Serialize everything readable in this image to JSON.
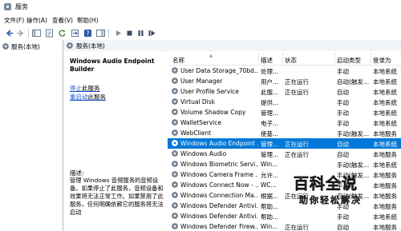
{
  "window": {
    "title": "服务"
  },
  "menu": [
    "文件(F)",
    "操作(A)",
    "查看(V)",
    "帮助(H)"
  ],
  "toolbar": {
    "icons": [
      "back-icon",
      "forward-icon",
      "console-tree-icon",
      "properties-icon",
      "refresh-icon",
      "export-icon",
      "help-icon",
      "show-hide-icon",
      "play-icon",
      "stop-icon",
      "pause-icon",
      "restart-icon"
    ]
  },
  "tree": {
    "root_label": "服务(本地)"
  },
  "panel": {
    "header": "服务(本地)"
  },
  "details": {
    "service_name": "Windows Audio Endpoint Builder",
    "stop_link": "停止",
    "stop_suffix": "此服务",
    "restart_link": "重启动",
    "restart_suffix": "此服务",
    "desc_label": "描述:",
    "desc_text": "管理 Windows 音频服务的音频设备。如果停止了此服务，音频设备和效果将无法正常工作。如果禁用了此服务，任何明确依赖它的服务将无法启动"
  },
  "columns": {
    "name": "名称",
    "desc": "描述",
    "status": "状态",
    "startup": "启动类型",
    "logon": "登录为"
  },
  "rows": [
    {
      "name": "User Data Storage_70bd...",
      "desc": "处理...",
      "status": "",
      "startup": "手动",
      "logon": "本地系统"
    },
    {
      "name": "User Manager",
      "desc": "用户...",
      "status": "正在运行",
      "startup": "自动(触发...",
      "logon": "本地系统"
    },
    {
      "name": "User Profile Service",
      "desc": "此服...",
      "status": "正在运行",
      "startup": "自动",
      "logon": "本地系统"
    },
    {
      "name": "Virtual Disk",
      "desc": "提供...",
      "status": "",
      "startup": "手动",
      "logon": "本地系统"
    },
    {
      "name": "Volume Shadow Copy",
      "desc": "管理...",
      "status": "",
      "startup": "手动",
      "logon": "本地系统"
    },
    {
      "name": "WalletService",
      "desc": "电子...",
      "status": "",
      "startup": "手动",
      "logon": "本地系统"
    },
    {
      "name": "WebClient",
      "desc": "使基...",
      "status": "",
      "startup": "手动(触发...",
      "logon": "本地服务"
    },
    {
      "name": "Windows Audio Endpoint ...",
      "desc": "管理...",
      "status": "正在运行",
      "startup": "自动",
      "logon": "本地系统",
      "selected": true
    },
    {
      "name": "Windows Audio",
      "desc": "管理...",
      "status": "正在运行",
      "startup": "自动",
      "logon": "本地服务"
    },
    {
      "name": "Windows Biometric Servi...",
      "desc": "Win...",
      "status": "",
      "startup": "手动(触发...",
      "logon": "本地系统"
    },
    {
      "name": "Windows Camera Frame ...",
      "desc": "允许...",
      "status": "",
      "startup": "手动(触发...",
      "logon": "本地服务"
    },
    {
      "name": "Windows Connect Now - ...",
      "desc": "WC...",
      "status": "",
      "startup": "手动",
      "logon": "本地服务"
    },
    {
      "name": "Windows Connection Ma...",
      "desc": "根据...",
      "status": "正在运行",
      "startup": "自动(触发...",
      "logon": "本地服务"
    },
    {
      "name": "Windows Defender Antivi...",
      "desc": "帮助...",
      "status": "",
      "startup": "手动",
      "logon": "本地服务"
    },
    {
      "name": "Windows Defender Antivi...",
      "desc": "帮助...",
      "status": "",
      "startup": "手动",
      "logon": "本地系统"
    },
    {
      "name": "Windows Defender Firew...",
      "desc": "Win...",
      "status": "正在运行",
      "startup": "自动",
      "logon": "本地服务"
    }
  ],
  "watermark": {
    "logo": "百科全说",
    "sub": "助你轻松解决"
  }
}
